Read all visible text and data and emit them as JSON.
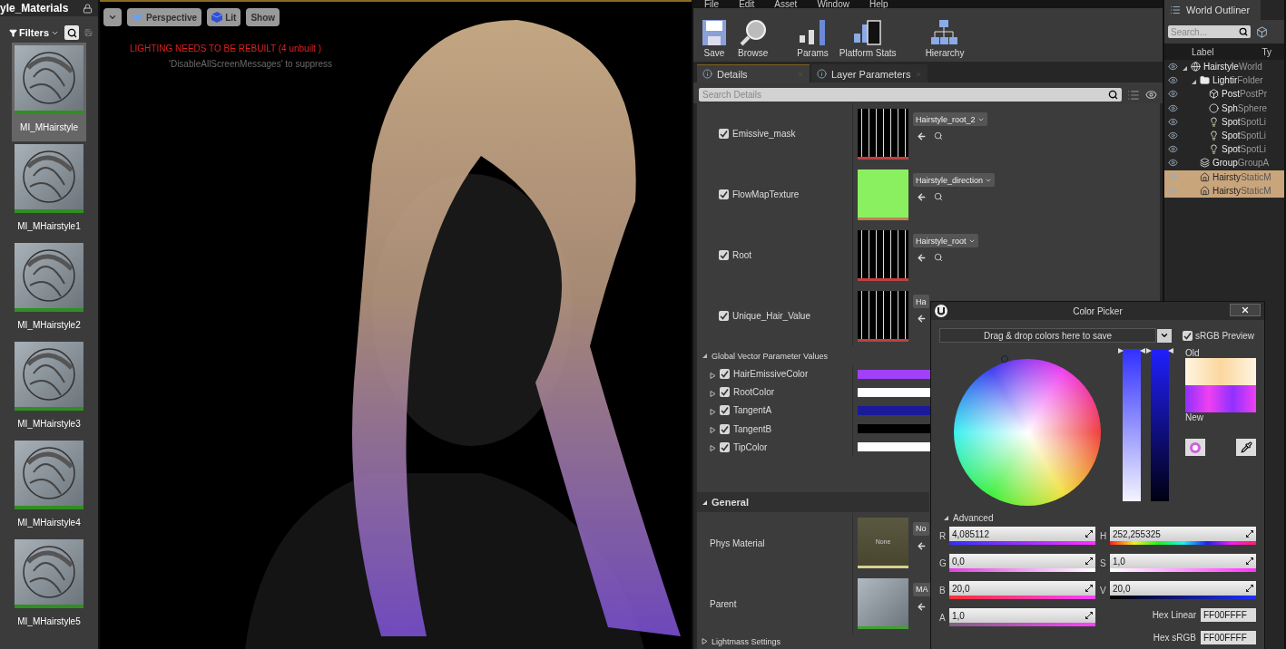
{
  "content_browser": {
    "title": "yle_Materials",
    "filters": "Filters",
    "assets": [
      {
        "name": "MI_MHairstyle",
        "selected": true
      },
      {
        "name": "MI_MHairstyle1",
        "selected": false
      },
      {
        "name": "MI_MHairstyle2",
        "selected": false
      },
      {
        "name": "MI_MHairstyle3",
        "selected": false
      },
      {
        "name": "MI_MHairstyle4",
        "selected": false
      },
      {
        "name": "MI_MHairstyle5",
        "selected": false
      }
    ]
  },
  "viewport": {
    "buttons": [
      {
        "label": "Perspective",
        "kind": "camera"
      },
      {
        "label": "Lit",
        "kind": "cube"
      },
      {
        "label": "Show",
        "kind": "plain"
      }
    ],
    "warning": "LIGHTING NEEDS TO BE REBUILT (4 unbuilt )",
    "hint": "'DisableAllScreenMessages' to suppress"
  },
  "menu": [
    "File",
    "Edit",
    "Asset",
    "Window",
    "Help"
  ],
  "toolbar": [
    {
      "label": "Save",
      "kind": "save"
    },
    {
      "label": "Browse",
      "kind": "browse"
    },
    {
      "label": "Params",
      "kind": "params"
    },
    {
      "label": "Platform Stats",
      "kind": "stats"
    },
    {
      "label": "Hierarchy",
      "kind": "hierarchy"
    }
  ],
  "details_tabs": [
    {
      "label": "Details",
      "selected": true
    },
    {
      "label": "Layer Parameters",
      "selected": false
    }
  ],
  "search": {
    "placeholder": "Search Details"
  },
  "texture_params": [
    {
      "name": "Emissive_mask",
      "checked": true,
      "asset": "Hairstyle_root_2",
      "kind": "mask",
      "caret": true
    },
    {
      "name": "FlowMapTexture",
      "checked": true,
      "asset": "Hairstyle_direction",
      "kind": "flow",
      "caret": true
    },
    {
      "name": "Root",
      "checked": true,
      "asset": "Hairstyle_root",
      "kind": "mask",
      "caret": true
    },
    {
      "name": "Unique_Hair_Value",
      "checked": true,
      "asset": "Ha",
      "kind": "mask",
      "caret": false
    }
  ],
  "vector_section": {
    "title": "Global Vector Parameter Values",
    "expanded": true
  },
  "vector_params": [
    {
      "name": "HairEmissiveColor",
      "checked": true,
      "expanded": false,
      "color": "#a040f8"
    },
    {
      "name": "RootColor",
      "checked": true,
      "expanded": false,
      "color": "#ffffff"
    },
    {
      "name": "TangentA",
      "checked": true,
      "expanded": false,
      "color": "#1a1a9a"
    },
    {
      "name": "TangentB",
      "checked": true,
      "expanded": false,
      "color": "#000000"
    },
    {
      "name": "TipColor",
      "checked": true,
      "expanded": false,
      "color": "#ffffff"
    }
  ],
  "general": {
    "title": "General",
    "expanded": true,
    "rows": [
      {
        "label": "Phys Material",
        "thumb": "None",
        "asset": "No",
        "kind": "physmat"
      },
      {
        "label": "Parent",
        "asset": "MA",
        "kind": "material"
      }
    ]
  },
  "lightmass": {
    "title": "Lightmass Settings",
    "expanded": false
  },
  "outliner": {
    "title": "World Outliner",
    "search_placeholder": "Search...",
    "columns": [
      "Label",
      "Ty"
    ],
    "items": [
      {
        "label": "Hairstyle",
        "type": "World",
        "kind": "world",
        "selected": false,
        "expanded": true,
        "children": [
          {
            "label": "Lightir",
            "type": "Folder",
            "kind": "folder",
            "selected": false,
            "expanded": true,
            "children": [
              {
                "label": "Post",
                "type": "PostPr",
                "kind": "volume",
                "selected": false
              },
              {
                "label": "Sph",
                "type": "Sphere",
                "kind": "sphere",
                "selected": false
              },
              {
                "label": "Spot",
                "type": "SpotLi",
                "kind": "light",
                "selected": false
              },
              {
                "label": "Spot",
                "type": "SpotLi",
                "kind": "light",
                "selected": false
              },
              {
                "label": "Spot",
                "type": "SpotLi",
                "kind": "light",
                "selected": false
              }
            ]
          },
          {
            "label": "Group",
            "type": "GroupA",
            "kind": "group",
            "selected": false
          },
          {
            "label": "Hairsty",
            "type": "StaticM",
            "kind": "mesh",
            "selected": true
          },
          {
            "label": "Hairsty",
            "type": "StaticM",
            "kind": "mesh",
            "selected": true
          }
        ]
      }
    ]
  },
  "color_picker": {
    "title": "Color Picker",
    "swatch_hint": "Drag & drop colors here to save",
    "srgb_preview": {
      "label": "sRGB Preview",
      "checked": true
    },
    "old_label": "Old",
    "new_label": "New",
    "advanced": "Advanced",
    "saturation_slider": {
      "level": 1
    },
    "value_slider": {
      "level": 1
    },
    "rgba": [
      {
        "name": "R",
        "value": "4,085112"
      },
      {
        "name": "G",
        "value": "0,0"
      },
      {
        "name": "B",
        "value": "20,0"
      },
      {
        "name": "A",
        "value": "1,0"
      }
    ],
    "hsv": [
      {
        "name": "H",
        "value": "252,255325"
      },
      {
        "name": "S",
        "value": "1,0"
      },
      {
        "name": "V",
        "value": "20,0"
      }
    ],
    "hex": [
      {
        "label": "Hex Linear",
        "value": "FF00FFFF"
      },
      {
        "label": "Hex sRGB",
        "value": "FF00FFFF"
      }
    ]
  }
}
